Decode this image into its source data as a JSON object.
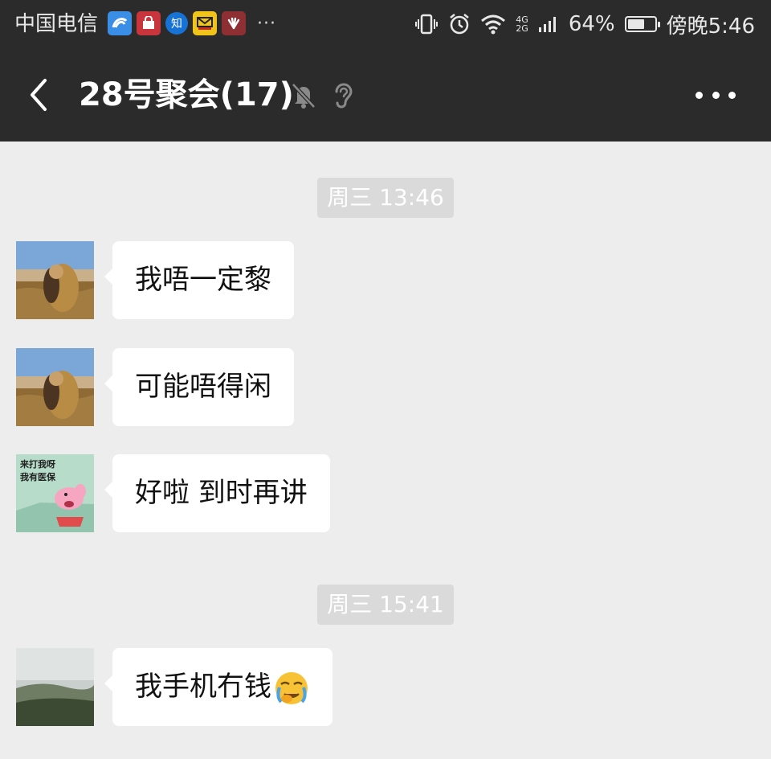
{
  "status_bar": {
    "carrier": "中国电信",
    "notification_icons": [
      "app-icon",
      "shopping-icon",
      "zhihu-icon",
      "mail-icon",
      "huawei-icon"
    ],
    "zhihu_label": "知",
    "more": "···",
    "battery_percent": "64%",
    "battery_level": 0.64,
    "time": "傍晚5:46",
    "signal": [
      "4G",
      "2G"
    ]
  },
  "nav": {
    "title": "28号聚会(17)"
  },
  "chat": {
    "dividers": [
      {
        "text": "周三 13:46"
      },
      {
        "text": "周三 15:41"
      }
    ],
    "messages": [
      {
        "text": "我唔一定黎",
        "avatar": "lion-photo-avatar"
      },
      {
        "text": "可能唔得闲",
        "avatar": "lion-photo-avatar"
      },
      {
        "text": "好啦 到时再讲",
        "avatar": "peppa-pig-avatar",
        "avatar_text_1": "来打我呀",
        "avatar_text_2": "我有医保"
      },
      {
        "text": "我手机冇钱",
        "avatar": "landscape-avatar",
        "emoji": "crying-face-emoji"
      }
    ]
  },
  "colors": {
    "header_bg": "#2b2b2b",
    "chat_bg": "#ededed",
    "bubble_bg": "#ffffff",
    "divider_bg": "#dadada"
  }
}
